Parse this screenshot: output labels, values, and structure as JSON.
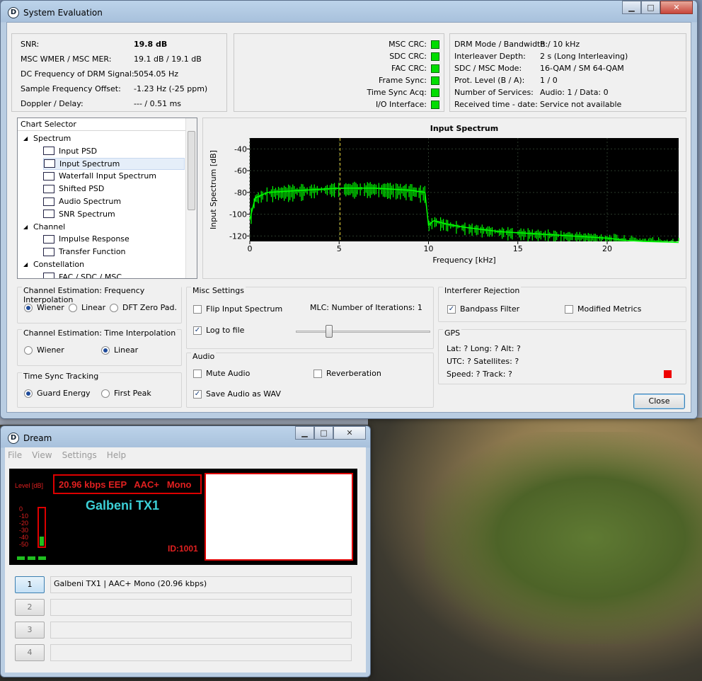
{
  "sys_window": {
    "title": "System Evaluation",
    "left_info": [
      {
        "k": "SNR:",
        "v": "19.8 dB",
        "bold": true
      },
      {
        "k": "MSC WMER / MSC MER:",
        "v": "19.1 dB / 19.1 dB"
      },
      {
        "k": "DC Frequency of DRM Signal:",
        "v": "5054.05 Hz"
      },
      {
        "k": "Sample Frequency Offset:",
        "v": "-1.23 Hz (-25 ppm)"
      },
      {
        "k": "Doppler / Delay:",
        "v": "--- / 0.51 ms"
      }
    ],
    "status_leds": [
      "MSC CRC:",
      "SDC CRC:",
      "FAC CRC:",
      "Frame Sync:",
      "Time Sync Acq:",
      "I/O Interface:"
    ],
    "led_color": "#00dd00",
    "right_info": [
      {
        "k": "DRM Mode / Bandwidth:",
        "v": "B / 10 kHz"
      },
      {
        "k": "Interleaver Depth:",
        "v": "2 s (Long Interleaving)"
      },
      {
        "k": "SDC / MSC Mode:",
        "v": "16-QAM / SM 64-QAM"
      },
      {
        "k": "Prot. Level (B / A):",
        "v": "1 / 0"
      },
      {
        "k": "Number of Services:",
        "v": "Audio: 1 / Data: 0"
      },
      {
        "k": "Received time - date:",
        "v": "Service not available"
      }
    ],
    "chart_selector": {
      "header": "Chart Selector",
      "items": [
        {
          "label": "Spectrum",
          "level": 0
        },
        {
          "label": "Input PSD",
          "level": 1,
          "icon": "input-psd-icon"
        },
        {
          "label": "Input Spectrum",
          "level": 1,
          "icon": "input-spectrum-icon",
          "selected": true
        },
        {
          "label": "Waterfall Input Spectrum",
          "level": 1,
          "icon": "waterfall-icon"
        },
        {
          "label": "Shifted PSD",
          "level": 1,
          "icon": "shifted-psd-icon"
        },
        {
          "label": "Audio Spectrum",
          "level": 1,
          "icon": "audio-spectrum-icon"
        },
        {
          "label": "SNR Spectrum",
          "level": 1,
          "icon": "snr-spectrum-icon"
        },
        {
          "label": "Channel",
          "level": 0
        },
        {
          "label": "Impulse Response",
          "level": 1,
          "icon": "impulse-response-icon"
        },
        {
          "label": "Transfer Function",
          "level": 1,
          "icon": "transfer-function-icon"
        },
        {
          "label": "Constellation",
          "level": 0
        },
        {
          "label": "FAC / SDC / MSC",
          "level": 1,
          "icon": "constellation-icon"
        }
      ]
    },
    "freq_interp": {
      "label": "Channel Estimation: Frequency Interpolation",
      "options": [
        "Wiener",
        "Linear",
        "DFT Zero Pad."
      ],
      "selected": 0
    },
    "time_interp": {
      "label": "Channel Estimation: Time Interpolation",
      "options": [
        "Wiener",
        "Linear"
      ],
      "selected": 1
    },
    "time_sync": {
      "label": "Time Sync Tracking",
      "options": [
        "Guard Energy",
        "First Peak"
      ],
      "selected": 0
    },
    "misc": {
      "label": "Misc Settings",
      "flip": "Flip Input Spectrum",
      "log": "Log to file",
      "mlc": "MLC: Number of Iterations: 1",
      "mlc_value": 1,
      "mlc_max": 4
    },
    "audio": {
      "label": "Audio",
      "mute": "Mute Audio",
      "reverb": "Reverberation",
      "save_wav": "Save Audio as WAV"
    },
    "interferer": {
      "label": "Interferer Rejection",
      "bandpass": "Bandpass Filter",
      "modified": "Modified Metrics"
    },
    "gps": {
      "label": "GPS",
      "line1": "Lat: ?  Long: ?  Alt: ?",
      "line2": "UTC: ?  Satellites: ?",
      "line3": "Speed: ?  Track: ?",
      "status_color": "#ee0000"
    },
    "close_label": "Close"
  },
  "chart_data": {
    "type": "line",
    "title": "Input Spectrum",
    "xlabel": "Frequency [kHz]",
    "ylabel": "Input Spectrum [dB]",
    "xlim": [
      0,
      24
    ],
    "ylim": [
      -125,
      -30
    ],
    "xticks": [
      "0",
      "5",
      "10",
      "15",
      "20"
    ],
    "yticks": [
      "-40",
      "-60",
      "-80",
      "-100",
      "-120"
    ],
    "dc_marker_khz": 5.05,
    "series": [
      {
        "x": [
          0,
          0.3,
          1,
          2,
          3,
          4,
          5,
          6,
          7,
          8,
          9,
          9.8,
          10,
          10.3,
          11,
          12,
          13,
          14,
          15,
          16,
          17,
          18,
          19,
          20,
          21,
          22,
          24
        ],
        "values": [
          -105,
          -85,
          -80,
          -79,
          -78,
          -77,
          -76,
          -76,
          -76,
          -77,
          -78,
          -80,
          -110,
          -106,
          -109,
          -112,
          -114,
          -116,
          -117,
          -118,
          -119,
          -120,
          -121,
          -122,
          -124,
          -125,
          -126
        ]
      }
    ],
    "grid": true,
    "line_color": "#00ff00",
    "background": "#000000"
  },
  "dream_window": {
    "title": "Dream",
    "menu": [
      "File",
      "View",
      "Settings",
      "Help"
    ],
    "level_label": "Level [dB]",
    "level_ticks": [
      "0",
      "-10",
      "-20",
      "-30",
      "-40",
      "-50"
    ],
    "level_fraction": 0.25,
    "codec_info": "20.96 kbps EEP   AAC+   Mono",
    "station": "Galbeni TX1",
    "id": "ID:1001",
    "services": [
      {
        "num": "1",
        "label": "Galbeni TX1  |   AAC+ Mono (20.96 kbps)",
        "active": true
      },
      {
        "num": "2",
        "label": ""
      },
      {
        "num": "3",
        "label": ""
      },
      {
        "num": "4",
        "label": ""
      }
    ]
  }
}
